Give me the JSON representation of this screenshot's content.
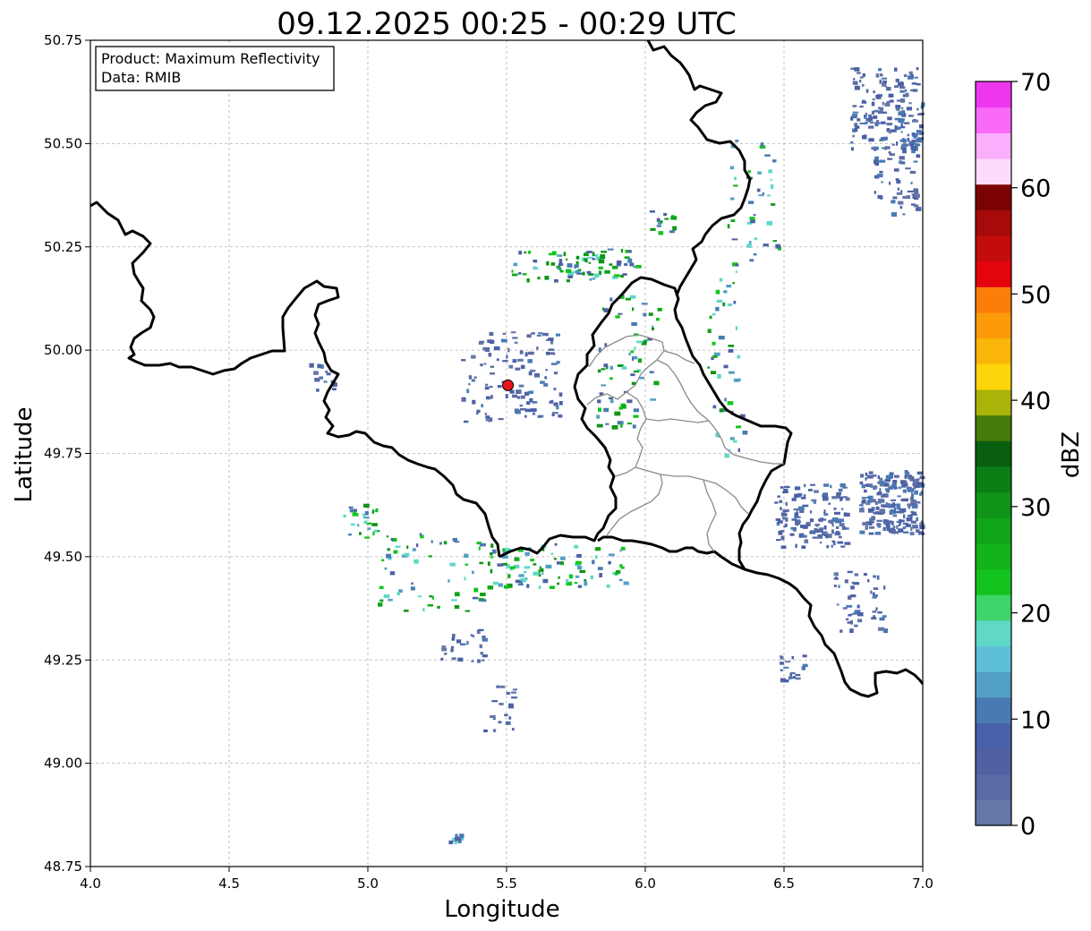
{
  "title": "09.12.2025 00:25 - 00:29 UTC",
  "xlabel": "Longitude",
  "ylabel": "Latitude",
  "info": {
    "product": "Product: Maximum Reflectivity",
    "data": "Data: RMIB"
  },
  "map": {
    "lon_range": [
      4.0,
      7.0
    ],
    "lat_range": [
      48.75,
      50.75
    ],
    "x_ticks": [
      "4.0",
      "4.5",
      "5.0",
      "5.5",
      "6.0",
      "6.5",
      "7.0"
    ],
    "y_ticks": [
      "48.75",
      "49.00",
      "49.25",
      "49.50",
      "49.75",
      "50.00",
      "50.25",
      "50.50",
      "50.75"
    ],
    "grid": true,
    "radar_site": {
      "lon": 5.505,
      "lat": 49.915,
      "color": "#e8141c"
    }
  },
  "colorbar": {
    "label": "dBZ",
    "ticks": [
      "0",
      "10",
      "20",
      "30",
      "40",
      "50",
      "60",
      "70"
    ],
    "range": [
      0,
      70
    ],
    "colors": [
      "#6477a6",
      "#5a6aa3",
      "#4f61a3",
      "#4961a8",
      "#4a7ab3",
      "#529fc4",
      "#5ec0d8",
      "#5fd8c8",
      "#3ed66a",
      "#14c41e",
      "#12b31b",
      "#10a418",
      "#0f9417",
      "#0c7e16",
      "#095f10",
      "#457c0a",
      "#aab30a",
      "#fcd60a",
      "#fcb50a",
      "#fc9a0a",
      "#fc7e0a",
      "#e3040e",
      "#c30c0c",
      "#a60a0a",
      "#7c0303",
      "#fddbfc",
      "#fbaefb",
      "#f96af9",
      "#ef36ef"
    ]
  }
}
